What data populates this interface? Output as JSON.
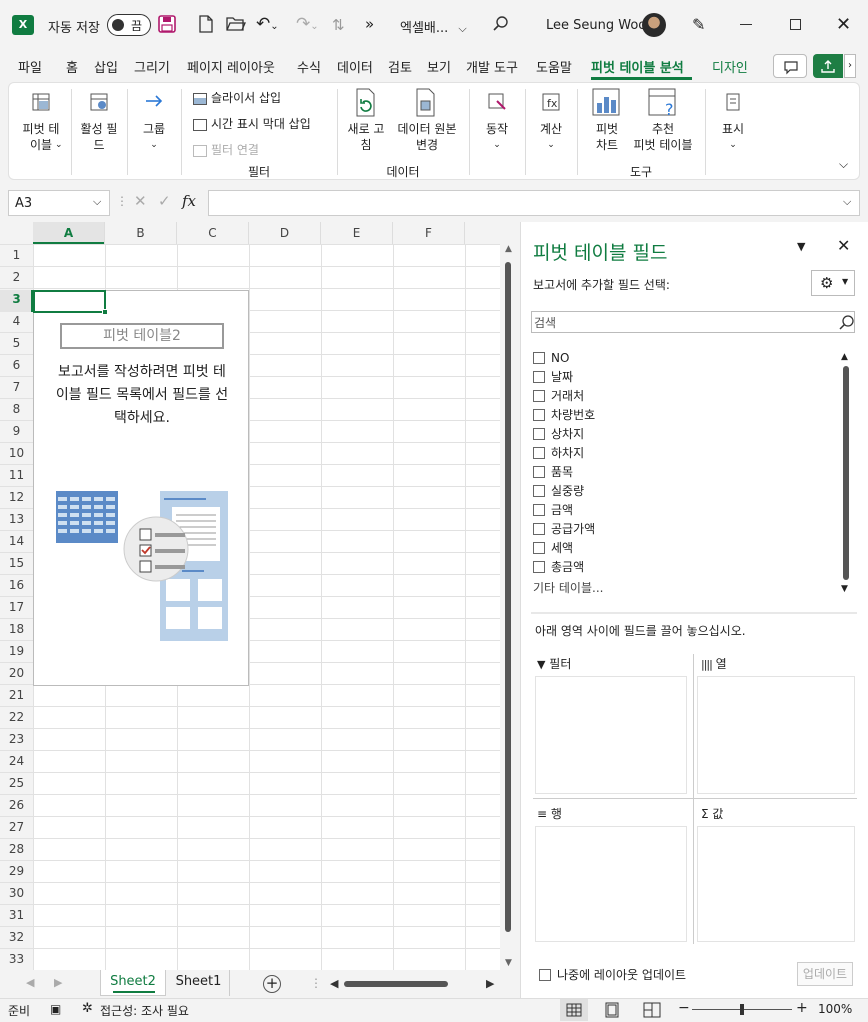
{
  "titlebar": {
    "autosave_label": "자동 저장",
    "autosave_state": "끔",
    "more": "»",
    "filename": "엑셀배...",
    "user_name": "Lee Seung Woo"
  },
  "menu": {
    "items": [
      "파일",
      "홈",
      "삽입",
      "그리기",
      "페이지 레이아웃",
      "수식",
      "데이터",
      "검토",
      "보기",
      "개발 도구",
      "도움말",
      "피벗 테이블 분석",
      "디자인"
    ],
    "active": "피벗 테이블 분석"
  },
  "ribbon": {
    "pivot_table": "피벗 테\n이블",
    "active_field": "활성 필\n드",
    "group": "그룹",
    "insert_slicer": "슬라이서 삽입",
    "insert_timeline": "시간 표시 막대 삽입",
    "filter_connections": "필터 연결",
    "group_filter": "필터",
    "refresh": "새로 고\n침",
    "change_source": "데이터 원본\n변경",
    "group_data": "데이터",
    "actions": "동작",
    "calculations": "계산",
    "pivot_chart": "피벗\n차트",
    "recommended": "추천\n피벗 테이블",
    "group_tools": "도구",
    "show": "표시"
  },
  "formula_bar": {
    "name_box": "A3",
    "fx": "fx",
    "formula": ""
  },
  "grid": {
    "columns": [
      "A",
      "B",
      "C",
      "D",
      "E",
      "F"
    ],
    "rows": [
      "1",
      "2",
      "3",
      "4",
      "5",
      "6",
      "7",
      "8",
      "9",
      "10",
      "11",
      "12",
      "13",
      "14",
      "15",
      "16",
      "17",
      "18",
      "19",
      "20",
      "21",
      "22",
      "23",
      "24",
      "25",
      "26",
      "27",
      "28",
      "29",
      "30",
      "31",
      "32",
      "33"
    ],
    "selected_cell": "A3",
    "pivot_placeholder": {
      "name": "피벗 테이블2",
      "instruction_line1": "보고서를 작성하려면 피벗 테",
      "instruction_line2": "이블 필드 목록에서 필드를 선",
      "instruction_line3": "택하세요."
    }
  },
  "sheet_tabs": [
    "Sheet2",
    "Sheet1"
  ],
  "active_sheet": "Sheet2",
  "status_bar": {
    "ready": "준비",
    "accessibility": "접근성: 조사 필요",
    "zoom": "100%"
  },
  "pivot_pane": {
    "title": "피벗 테이블 필드",
    "choose_label": "보고서에 추가할 필드 선택:",
    "search_placeholder": "검색",
    "fields": [
      "NO",
      "날짜",
      "거래처",
      "차량번호",
      "상차지",
      "하차지",
      "품목",
      "실중량",
      "금액",
      "공급가액",
      "세액",
      "총금액"
    ],
    "more_tables": "기타 테이블...",
    "drag_hint": "아래 영역 사이에 필드를 끌어 놓으십시오.",
    "areas": {
      "filters": "필터",
      "columns": "열",
      "rows": "행",
      "values": "값"
    },
    "defer_label": "나중에 레이아웃 업데이트",
    "update_button": "업데이트"
  },
  "colors": {
    "accent": "#107c41",
    "share": "#1e7e44",
    "selection": "#107c41"
  }
}
